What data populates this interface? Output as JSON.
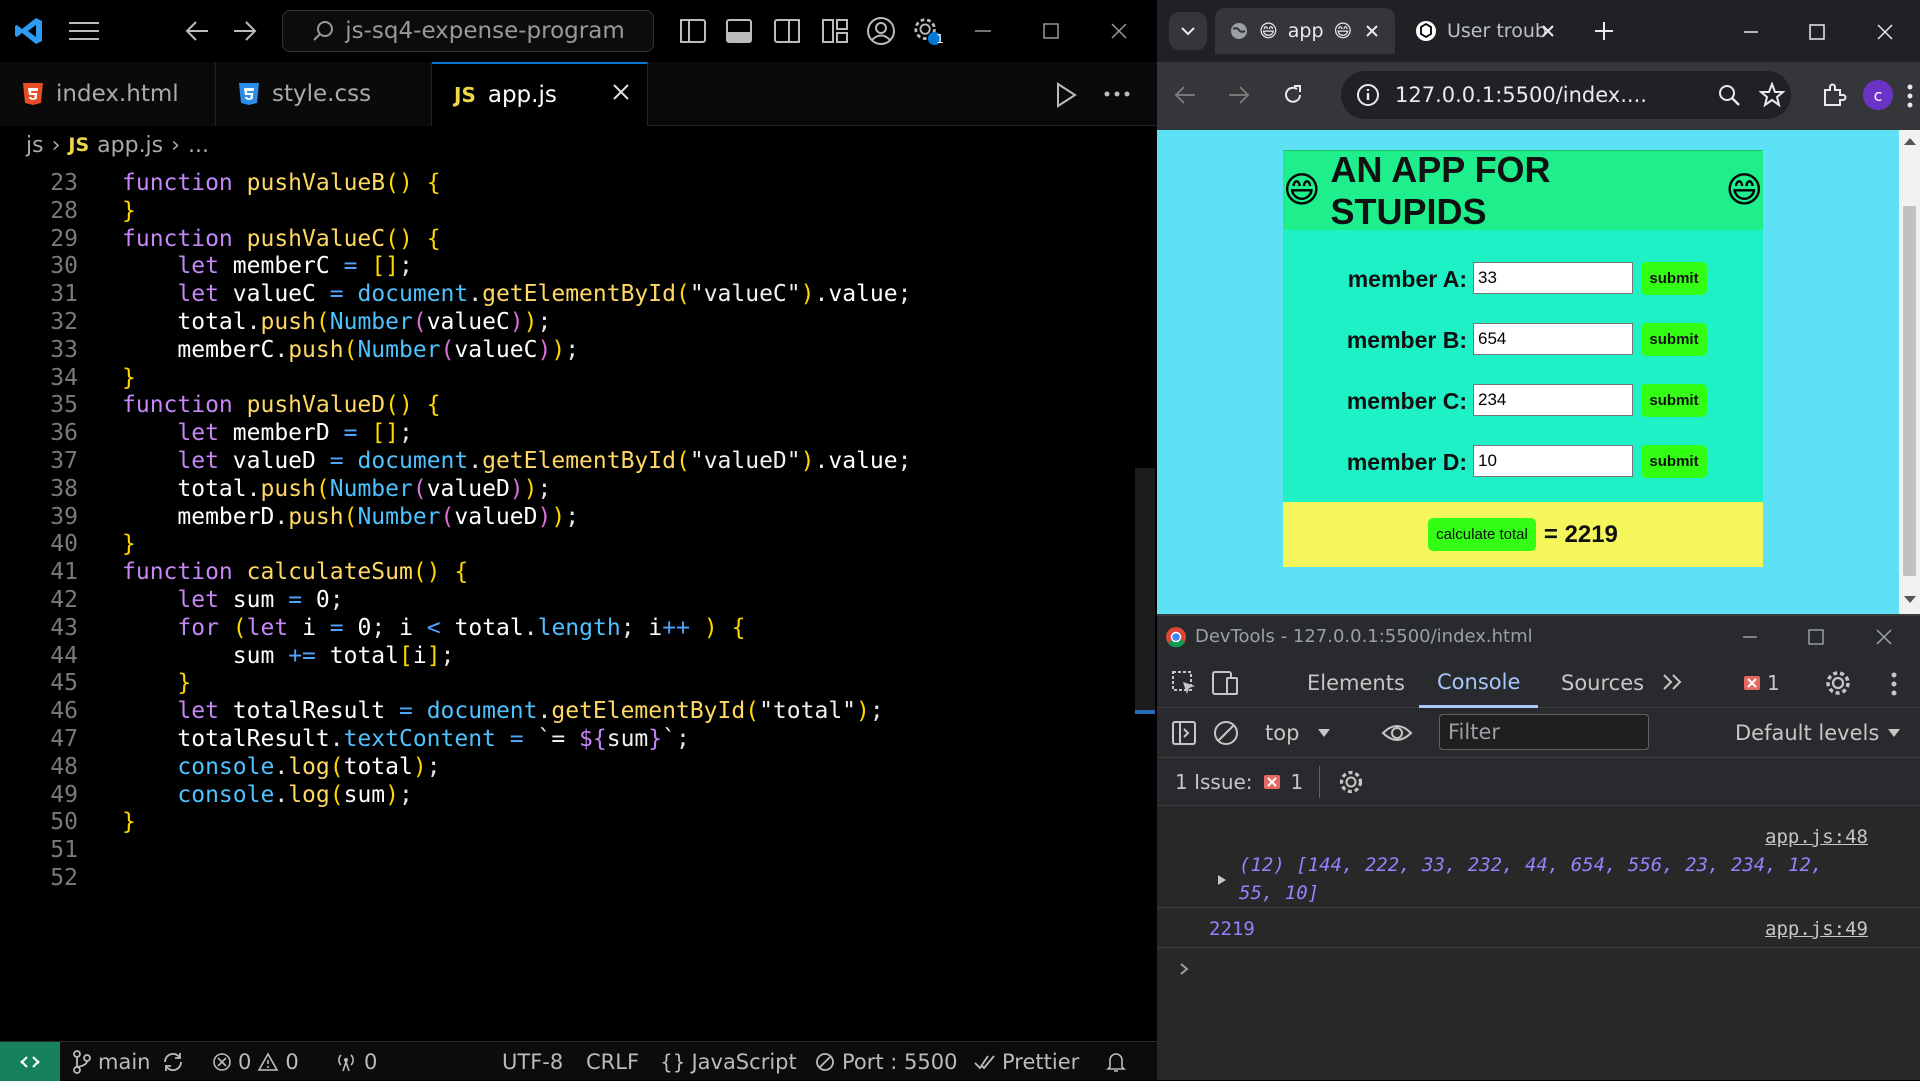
{
  "vscode": {
    "search": "js-sq4-expense-program",
    "notification_count": "1",
    "tabs": [
      {
        "label": "index.html",
        "icon": "html5-icon"
      },
      {
        "label": "style.css",
        "icon": "css3-icon"
      },
      {
        "label": "app.js",
        "icon": "js-icon",
        "badge": "JS"
      }
    ],
    "breadcrumb": {
      "folder": "js",
      "badge": "JS",
      "file": "app.js",
      "more": "..."
    },
    "lines": [
      {
        "n": "23",
        "code": "function pushValueB() {"
      },
      {
        "n": "28",
        "code": "}"
      },
      {
        "n": "29",
        "code": "function pushValueC() {"
      },
      {
        "n": "30",
        "code": "    let memberC = [];"
      },
      {
        "n": "31",
        "code": "    let valueC = document.getElementById(\"valueC\").value;"
      },
      {
        "n": "32",
        "code": "    total.push(Number(valueC));"
      },
      {
        "n": "33",
        "code": "    memberC.push(Number(valueC));"
      },
      {
        "n": "34",
        "code": "}"
      },
      {
        "n": "35",
        "code": "function pushValueD() {"
      },
      {
        "n": "36",
        "code": "    let memberD = [];"
      },
      {
        "n": "37",
        "code": "    let valueD = document.getElementById(\"valueD\").value;"
      },
      {
        "n": "38",
        "code": "    total.push(Number(valueD));"
      },
      {
        "n": "39",
        "code": "    memberD.push(Number(valueD));"
      },
      {
        "n": "40",
        "code": "}"
      },
      {
        "n": "41",
        "code": "function calculateSum() {"
      },
      {
        "n": "42",
        "code": "    let sum = 0;"
      },
      {
        "n": "43",
        "code": "    for (let i = 0; i < total.length; i++ ) {"
      },
      {
        "n": "44",
        "code": "        sum += total[i];"
      },
      {
        "n": "45",
        "code": "    }"
      },
      {
        "n": "46",
        "code": "    let totalResult = document.getElementById(\"total\");"
      },
      {
        "n": "47",
        "code": "    totalResult.textContent = `= ${sum}`;"
      },
      {
        "n": "48",
        "code": "    console.log(total);"
      },
      {
        "n": "49",
        "code": "    console.log(sum);"
      },
      {
        "n": "50",
        "code": "}"
      },
      {
        "n": "51",
        "code": ""
      },
      {
        "n": "52",
        "code": ""
      }
    ],
    "status": {
      "branch": "main",
      "errors": "0",
      "warnings": "0",
      "ports": "0",
      "encoding": "UTF-8",
      "eol": "CRLF",
      "language": "JavaScript",
      "port": "Port : 5500",
      "prettier": "Prettier"
    }
  },
  "chrome": {
    "tabs": [
      {
        "label": "app",
        "active": true
      },
      {
        "label": "User troub",
        "active": false
      }
    ],
    "url": "127.0.0.1:5500/index....",
    "profile": "c",
    "app": {
      "title": "AN APP FOR STUPIDS",
      "members": [
        {
          "label": "member A:",
          "value": "33",
          "button": "submit"
        },
        {
          "label": "member B:",
          "value": "654",
          "button": "submit"
        },
        {
          "label": "member C:",
          "value": "234",
          "button": "submit"
        },
        {
          "label": "member D:",
          "value": "10",
          "button": "submit"
        }
      ],
      "calculate_label": "calculate total",
      "total": "= 2219"
    },
    "devtools": {
      "title": "DevTools - 127.0.0.1:5500/index.html",
      "tabs": [
        "Elements",
        "Console",
        "Sources"
      ],
      "active_tab": "Console",
      "error_count": "1",
      "context": "top",
      "filter_placeholder": "Filter",
      "levels": "Default levels",
      "issues_label": "1 Issue:",
      "issues_count": "1",
      "console": [
        {
          "source": "app.js:48",
          "line1": "(12) [144, 222, 33, 232, 44, 654, 556, 23, 234, 12,",
          "line2": "55, 10]"
        },
        {
          "source": "app.js:49",
          "line1": "2219"
        }
      ]
    }
  }
}
